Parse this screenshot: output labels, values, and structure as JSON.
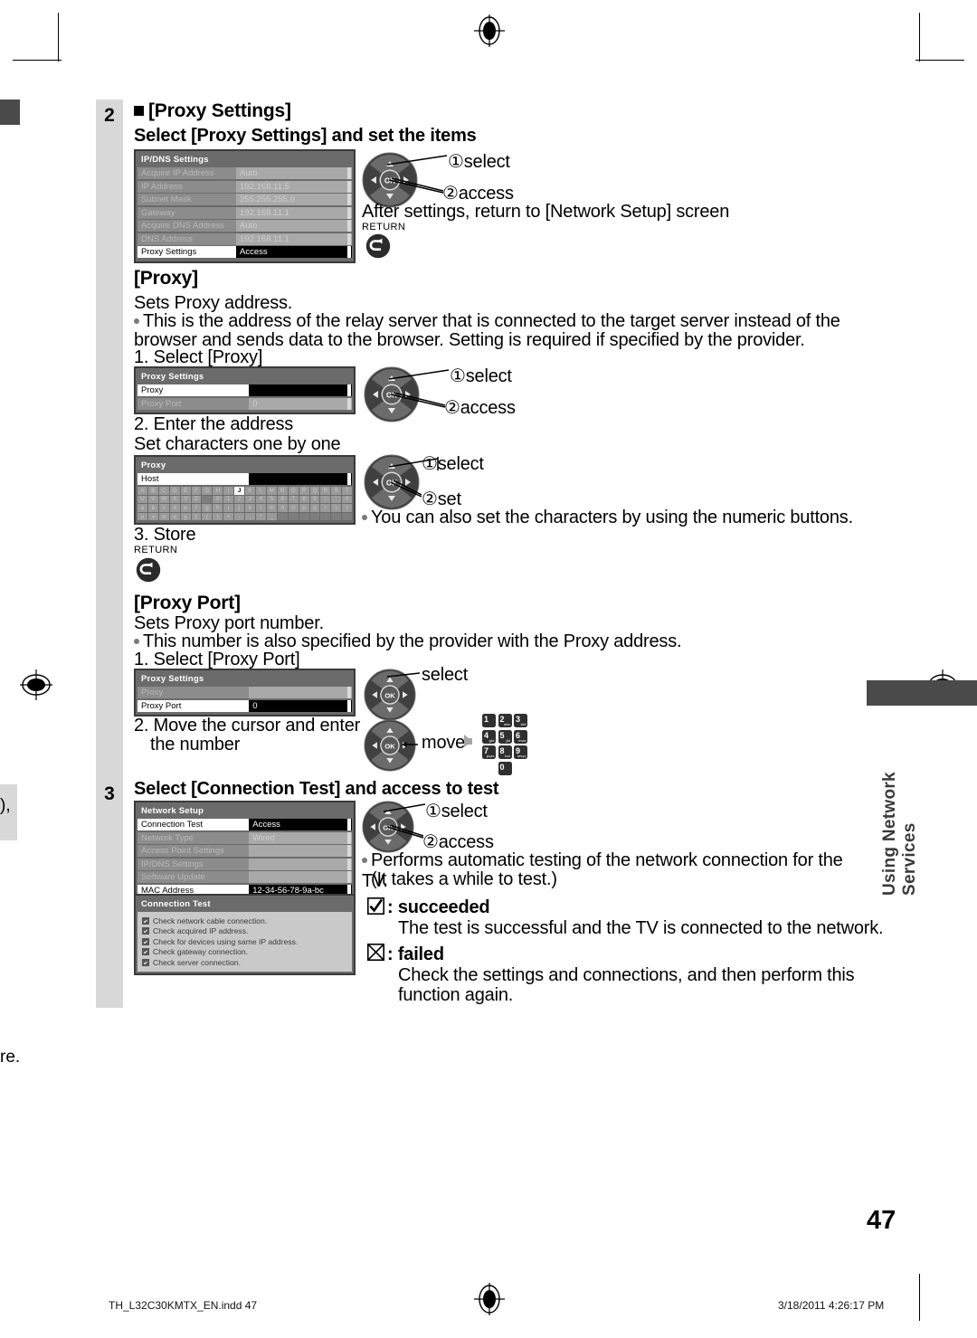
{
  "page": {
    "number": "47",
    "side_tab": "Using Network Services",
    "footer_file": "TH_L32C30KMTX_EN.indd   47",
    "footer_date": "3/18/2011   4:26:17 PM",
    "left_fragment_top": "),",
    "left_fragment_bottom": "re."
  },
  "step2": {
    "number": "2",
    "heading": "[Proxy Settings]",
    "subheading": "Select [Proxy Settings] and set the items",
    "osd": {
      "title": "IP/DNS Settings",
      "rows": [
        {
          "label": "Acquire IP Address",
          "value": "Auto",
          "state": "dim"
        },
        {
          "label": "IP Address",
          "value": "192.168.11.5",
          "state": "dim"
        },
        {
          "label": "Subnet Mask",
          "value": "255.255.255.0",
          "state": "dim"
        },
        {
          "label": "Gateway",
          "value": "192.168.11.1",
          "state": "dim"
        },
        {
          "label": "Acquire DNS Address",
          "value": "Auto",
          "state": "dim"
        },
        {
          "label": "DNS Address",
          "value": "192.168.11.1",
          "state": "dim"
        },
        {
          "label": "Proxy Settings",
          "value": "Access",
          "state": "sel"
        }
      ]
    },
    "callout_1": "select",
    "callout_2": "access",
    "after_text": "After settings, return to [Network Setup] screen",
    "return_label": "RETURN"
  },
  "proxy": {
    "title": "[Proxy]",
    "desc": "Sets Proxy address.",
    "note": "This is the address of the relay server that is connected to the target server instead of the browser and sends data to the browser. Setting is required if specified by the provider.",
    "step1": "1. Select [Proxy]",
    "osd1": {
      "title": "Proxy Settings",
      "rows": [
        {
          "label": "Proxy",
          "value": "",
          "state": "sel"
        },
        {
          "label": "Proxy Port",
          "value": "0",
          "state": "dim"
        }
      ]
    },
    "callout_1": "select",
    "callout_2": "access",
    "step2_line1": "2. Enter the address",
    "step2_line2": "Set characters one by one",
    "keyboard": {
      "title": "Proxy",
      "host_label": "Host",
      "selected_key": "J",
      "rows": [
        [
          "A",
          "B",
          "C",
          "D",
          "E",
          "F",
          "G",
          "H",
          "I",
          "J",
          "K",
          "L",
          "M",
          "N",
          "O",
          "P",
          "Q",
          "R",
          "S",
          "T"
        ],
        [
          "U",
          "V",
          "W",
          "X",
          "Y",
          "Z",
          "",
          "0",
          "1",
          "2",
          "3",
          "4",
          "5",
          "6",
          "7",
          "8",
          "9",
          "!",
          ":",
          "#"
        ],
        [
          "a",
          "b",
          "c",
          "d",
          "e",
          "f",
          "g",
          "h",
          "i",
          "j",
          "k",
          "l",
          "m",
          "n",
          "o",
          "p",
          "q",
          "r",
          "s",
          "t"
        ],
        [
          "u",
          "v",
          "w",
          "x",
          "y",
          "z",
          "(",
          ")",
          "+",
          "-",
          ".",
          "*",
          "_",
          "",
          "",
          "",
          "",
          "",
          "",
          ""
        ]
      ]
    },
    "kb_callout_1": "select",
    "kb_callout_2": "set",
    "numeric_note": "You can also set the characters by using the numeric buttons.",
    "step3": "3. Store",
    "return_label": "RETURN"
  },
  "proxy_port": {
    "title": "[Proxy Port]",
    "desc": "Sets Proxy port number.",
    "note": "This number is also specified by the provider with the Proxy address.",
    "step1": "1. Select [Proxy Port]",
    "osd": {
      "title": "Proxy Settings",
      "rows": [
        {
          "label": "Proxy",
          "value": "",
          "state": "dim"
        },
        {
          "label": "Proxy Port",
          "value": "0",
          "state": "sel"
        }
      ]
    },
    "callout_select": "select",
    "step2_line1": "2. Move the cursor and enter",
    "step2_line2": "the number",
    "callout_move": "move",
    "keypad": [
      [
        {
          "n": "1",
          "s": ""
        },
        {
          "n": "2",
          "s": "abc"
        },
        {
          "n": "3",
          "s": "def"
        }
      ],
      [
        {
          "n": "4",
          "s": "ghi"
        },
        {
          "n": "5",
          "s": "jkl"
        },
        {
          "n": "6",
          "s": "mno"
        }
      ],
      [
        {
          "n": "7",
          "s": "pqrs"
        },
        {
          "n": "8",
          "s": "tuv"
        },
        {
          "n": "9",
          "s": "wxyz"
        }
      ]
    ],
    "keypad_zero": {
      "n": "0",
      "s": ""
    }
  },
  "step3": {
    "number": "3",
    "heading": "Select [Connection Test] and access to test",
    "osd": {
      "title": "Network Setup",
      "rows": [
        {
          "label": "Connection Test",
          "value": "Access",
          "state": "sel"
        },
        {
          "label": "Network Type",
          "value": "Wired",
          "state": "dim"
        },
        {
          "label": "Access Point Settings",
          "value": "",
          "state": "dim"
        },
        {
          "label": "IP/DNS Settings",
          "value": "",
          "state": "dim"
        },
        {
          "label": "Software Update",
          "value": "",
          "state": "dim"
        },
        {
          "label": "MAC Address",
          "value": "12-34-56-78-9a-bc",
          "state": "sel"
        }
      ]
    },
    "test_panel": {
      "title": "Connection Test",
      "items": [
        "Check network cable connection.",
        "Check acquired IP address.",
        "Check for devices using same IP address.",
        "Check gateway connection.",
        "Check server connection."
      ]
    },
    "callout_1": "select",
    "callout_2": "access",
    "perform_line1": "Performs automatic testing of the network connection for the TV.",
    "perform_line2": "(It takes a while to test.)",
    "succeeded_label": ": succeeded",
    "succeeded_text": "The test is successful and the TV is connected to the network.",
    "failed_label": ": failed",
    "failed_line1": "Check the settings and connections, and then perform this",
    "failed_line2": "function again."
  }
}
